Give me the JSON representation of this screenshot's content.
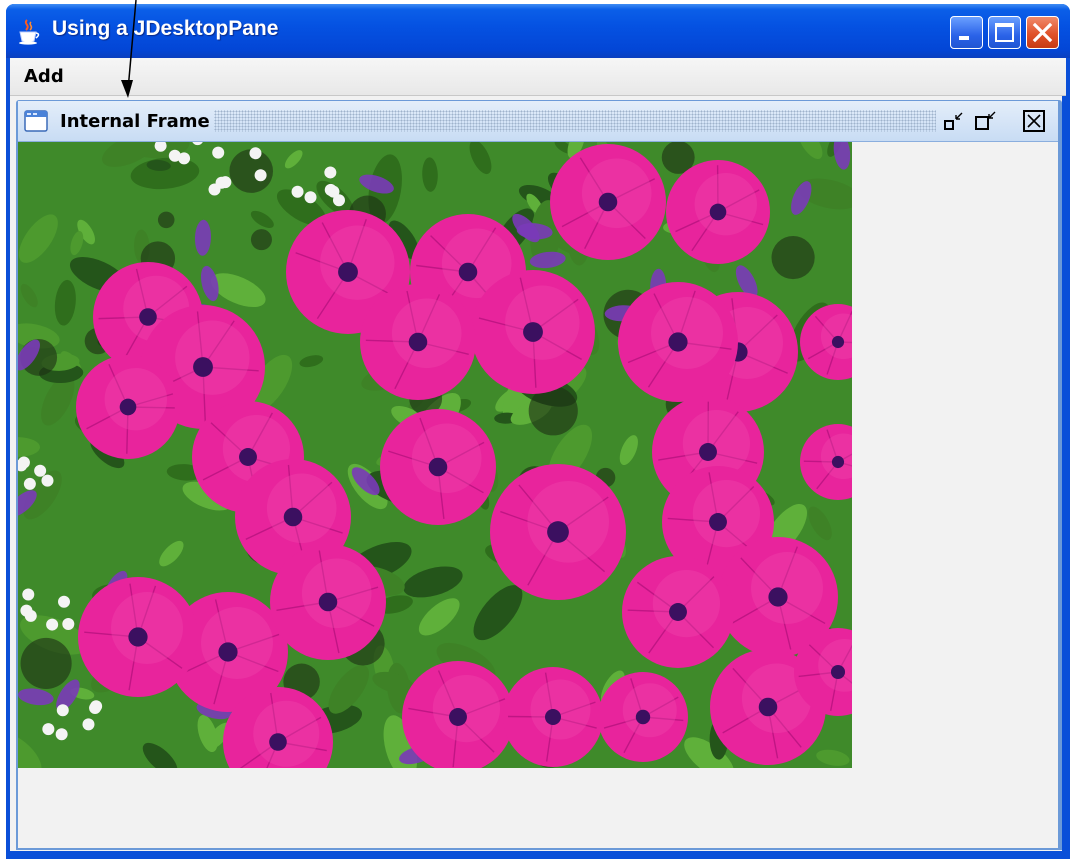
{
  "window": {
    "title": "Using a JDesktopPane",
    "app_icon": "java-cup-icon",
    "controls": [
      "minimize-icon",
      "maximize-icon",
      "close-icon"
    ],
    "colors": {
      "titlebar": "#0552e2",
      "close_button": "#e0522a",
      "frame": "#0a4fd8"
    }
  },
  "menubar": {
    "items": [
      {
        "label": "Add"
      }
    ]
  },
  "internal_frame": {
    "title": "Internal Frame",
    "icon": "frame-icon",
    "controls": [
      "iconify-icon",
      "maximize-icon",
      "close-icon"
    ]
  },
  "image": {
    "subject": "petunia-flowers-photo",
    "colors": {
      "petal": "#e8249c",
      "petal_dark": "#b0107a",
      "purple": "#7a3ab8",
      "foliage": "#3f8a2a",
      "white_flower": "#f4f4f4"
    }
  }
}
